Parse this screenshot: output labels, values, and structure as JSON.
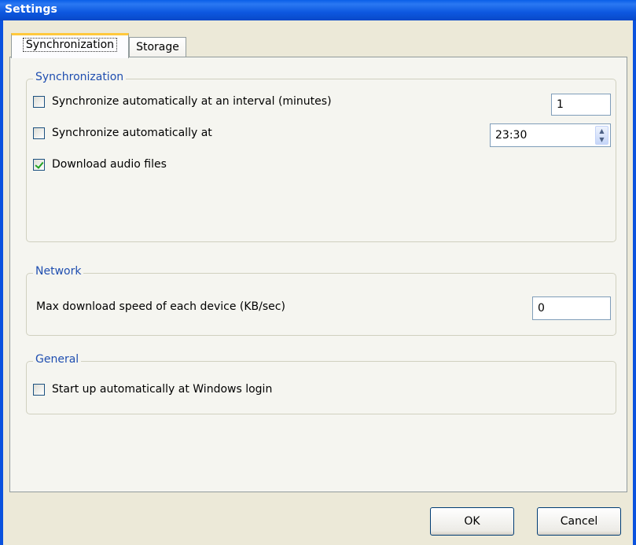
{
  "window": {
    "title": "Settings"
  },
  "tabs": [
    {
      "label": "Synchronization",
      "active": true
    },
    {
      "label": "Storage",
      "active": false
    }
  ],
  "sync": {
    "legend": "Synchronization",
    "interval_label": "Synchronize automatically at an interval (minutes)",
    "interval_checked": false,
    "interval_value": "1",
    "at_label": "Synchronize automatically at",
    "at_checked": false,
    "at_value": "23:30",
    "download_label": "Download audio files",
    "download_checked": true
  },
  "network": {
    "legend": "Network",
    "speed_label": "Max download speed of each device (KB/sec)",
    "speed_value": "0"
  },
  "general": {
    "legend": "General",
    "startup_label": "Start up automatically at Windows login",
    "startup_checked": false
  },
  "buttons": {
    "ok": "OK",
    "cancel": "Cancel"
  },
  "colors": {
    "titlebar": "#0a5ee8",
    "legend": "#1f4eb0",
    "tab_highlight": "#ffc83c"
  },
  "icons": {
    "checkbox_checked": "green-checkmark",
    "spinner": "up-down-arrows"
  }
}
